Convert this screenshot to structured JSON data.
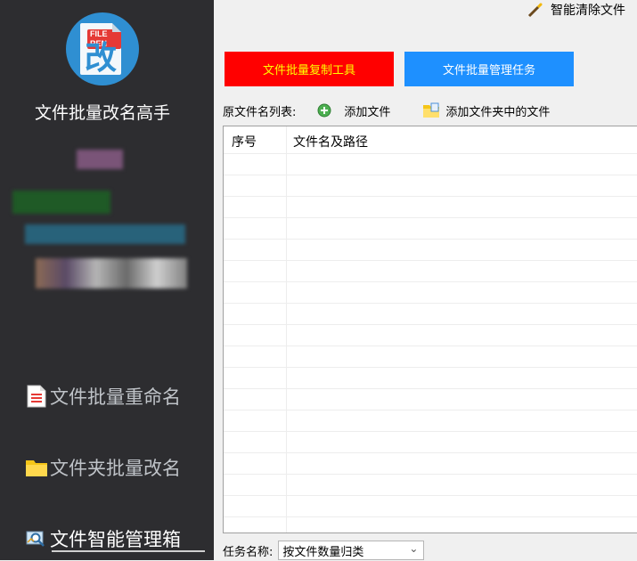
{
  "app": {
    "title": "文件批量改名高手",
    "logo_tag": "FILE REN",
    "logo_char": "改"
  },
  "sidebar": {
    "items": [
      {
        "label": "文件批量重命名",
        "icon": "document-list-icon"
      },
      {
        "label": "文件夹批量改名",
        "icon": "folder-icon"
      },
      {
        "label": "文件智能管理箱",
        "icon": "image-search-icon"
      }
    ]
  },
  "topbar": {
    "smart_clear_label": "智能清除文件"
  },
  "buttons": {
    "copy_tool": "文件批量复制工具",
    "manage_task": "文件批量管理任务"
  },
  "list_toolbar": {
    "label": "原文件名列表:",
    "add_file": "添加文件",
    "add_folder_files": "添加文件夹中的文件"
  },
  "grid": {
    "columns": [
      "序号",
      "文件名及路径"
    ],
    "rows": []
  },
  "task": {
    "label": "任务名称:",
    "selected": "按文件数量归类"
  },
  "colors": {
    "sidebar_bg": "#2d2d30",
    "copy_button_bg": "#ff0000",
    "copy_button_text": "#ffff00",
    "manage_button_bg": "#1e90ff"
  }
}
